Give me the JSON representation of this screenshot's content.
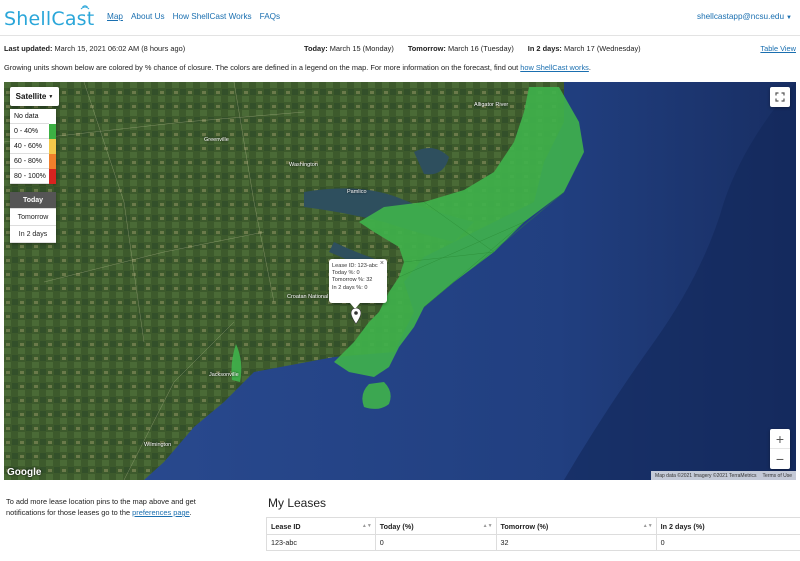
{
  "brand": {
    "name": "ShellCast",
    "color": "#2aa6d9"
  },
  "nav": [
    {
      "label": "Map",
      "active": true
    },
    {
      "label": "About Us",
      "active": false
    },
    {
      "label": "How ShellCast Works",
      "active": false
    },
    {
      "label": "FAQs",
      "active": false
    }
  ],
  "user": {
    "email": "shellcastapp@ncsu.edu"
  },
  "info": {
    "last_updated_label": "Last updated:",
    "last_updated_value": "March 15, 2021 06:02 AM (8 hours ago)",
    "today_label": "Today:",
    "today_value": "March 15 (Monday)",
    "tomorrow_label": "Tomorrow:",
    "tomorrow_value": "March 16 (Tuesday)",
    "in2_label": "In 2 days:",
    "in2_value": "March 17 (Wednesday)",
    "table_view": "Table View"
  },
  "legend_desc": {
    "text": "Growing units shown below are colored by % chance of closure. The colors are defined in a legend on the map. For more information on the forecast, find out ",
    "link": "how ShellCast works",
    "end": "."
  },
  "map": {
    "type_label": "Satellite",
    "legend": [
      {
        "label": "No data",
        "color": "#ffffff"
      },
      {
        "label": "0 - 40%",
        "color": "#3cb043"
      },
      {
        "label": "40 - 60%",
        "color": "#f2c84b"
      },
      {
        "label": "60 - 80%",
        "color": "#f07f2b"
      },
      {
        "label": "80 - 100%",
        "color": "#d7231f"
      }
    ],
    "days": [
      {
        "label": "Today",
        "active": true
      },
      {
        "label": "Tomorrow",
        "active": false
      },
      {
        "label": "In 2 days",
        "active": false
      }
    ],
    "popup": {
      "lease": "Lease ID: 123-abc",
      "today": "Today %: 0",
      "tomorrow": "Tomorrow %: 32",
      "in2": "In 2 days %: 0"
    },
    "places": [
      "Pamlico",
      "Croatan National Forest",
      "Wilmington",
      "Washington",
      "Greenville",
      "Jacksonville",
      "Alligator River"
    ],
    "google": "Google",
    "attribution": [
      "Map data ©2021 Imagery ©2021 TerraMetrics",
      "Terms of Use"
    ],
    "zoom_in": "+",
    "zoom_out": "−"
  },
  "bottom": {
    "pref_text": "To add more lease location pins to the map above and get notifications for those leases go to the ",
    "pref_link": "preferences page",
    "pref_end": ".",
    "leases_title": "My Leases",
    "columns": [
      "Lease ID",
      "Today (%)",
      "Tomorrow (%)",
      "In 2 days (%)"
    ],
    "rows": [
      [
        "123-abc",
        "0",
        "32",
        "0"
      ]
    ]
  }
}
